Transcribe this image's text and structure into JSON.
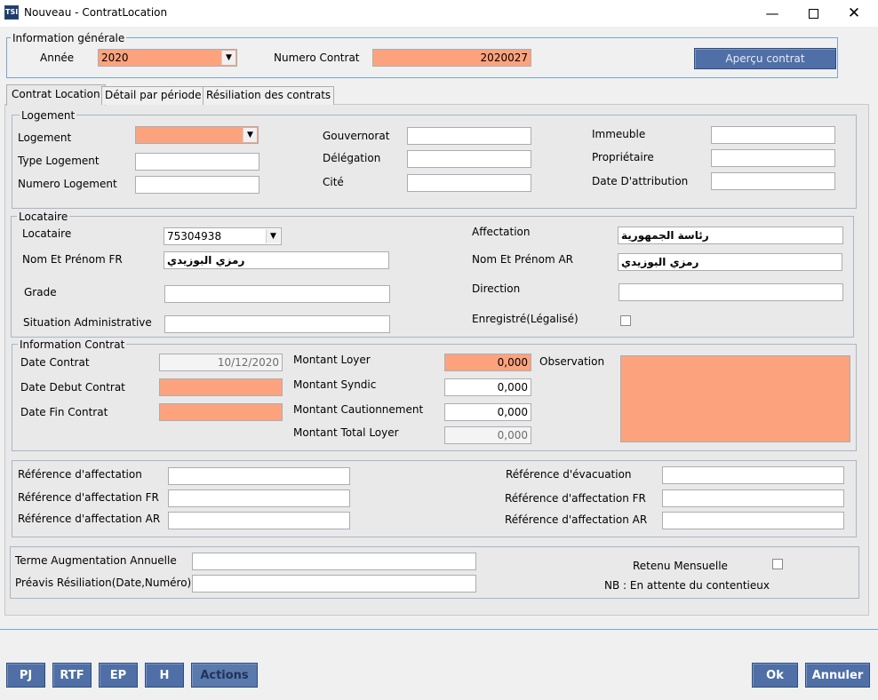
{
  "window": {
    "title": "Nouveau - ContratLocation",
    "app_icon": "TSI"
  },
  "general": {
    "legend": "Information générale",
    "annee_label": "Année",
    "annee_value": "2020",
    "numero_label": "Numero Contrat",
    "numero_value": "2020027",
    "apercu_label": "Aperçu contrat"
  },
  "tabs": [
    {
      "label": "Contrat Location"
    },
    {
      "label": "Détail par période"
    },
    {
      "label": "Résiliation des contrats"
    }
  ],
  "logement": {
    "legend": "Logement",
    "logement_label": "Logement",
    "logement_value": "",
    "type_label": "Type Logement",
    "numero_label": "Numero Logement",
    "gouvernorat_label": "Gouvernorat",
    "delegation_label": "Délégation",
    "cite_label": "Cité",
    "immeuble_label": "Immeuble",
    "proprietaire_label": "Propriétaire",
    "date_attribution_label": "Date D'attribution"
  },
  "locataire": {
    "legend": "Locataire",
    "locataire_label": "Locataire",
    "locataire_value": "75304938",
    "nom_fr_label": "Nom Et Prénom FR",
    "nom_fr_value": "رمزي البوزيدي",
    "grade_label": "Grade",
    "situation_label": "Situation Administrative",
    "affectation_label": "Affectation",
    "affectation_value": "رئاسة الجمهورية",
    "nom_ar_label": "Nom Et Prénom AR",
    "nom_ar_value": "رمزي البوزيدي",
    "direction_label": "Direction",
    "enregistre_label": "Enregistré(Légalisé)"
  },
  "contrat": {
    "legend": "Information Contrat",
    "date_contrat_label": "Date Contrat",
    "date_contrat_value": "10/12/2020",
    "date_debut_label": "Date Debut Contrat",
    "date_fin_label": "Date Fin Contrat",
    "loyer_label": "Montant Loyer",
    "loyer_value": "0,000",
    "syndic_label": "Montant Syndic",
    "syndic_value": "0,000",
    "caution_label": "Montant Cautionnement",
    "caution_value": "0,000",
    "total_label": "Montant Total Loyer",
    "total_value": "0,000",
    "observation_label": "Observation"
  },
  "references": {
    "aff_label": "Référence d'affectation",
    "aff_fr_label": "Référence d'affectation FR",
    "aff_ar_label": "Référence d'affectation AR",
    "evac_label": "Référence d'évacuation",
    "evac_fr_label": "Référence d'affectation FR",
    "evac_ar_label": "Référence d'affectation AR"
  },
  "misc": {
    "terme_label": "Terme Augmentation Annuelle",
    "preavis_label": "Préavis Résiliation(Date,Numéro)",
    "retenu_label": "Retenu Mensuelle",
    "nb_text": "NB : En attente du contentieux"
  },
  "footer": {
    "pj": "PJ",
    "rtf": "RTF",
    "ep": "EP",
    "h": "H",
    "actions": "Actions",
    "ok": "Ok",
    "annuler": "Annuler"
  },
  "colors": {
    "required": "#fca37e",
    "button": "#4f6fa6"
  }
}
